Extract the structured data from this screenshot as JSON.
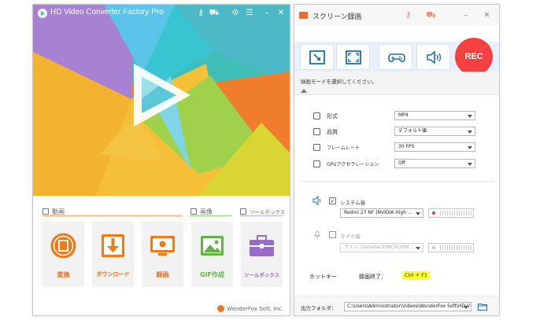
{
  "left_window": {
    "title": "HD Video Converter Factory Pro",
    "sections": {
      "video": "動画",
      "image": "画像",
      "toolbox": "ツールボックス"
    },
    "tiles": [
      {
        "label": "変換",
        "icon": "film-convert-icon"
      },
      {
        "label": "ダウンロード",
        "icon": "download-icon"
      },
      {
        "label": "録画",
        "icon": "screen-recorder-icon"
      },
      {
        "label": "GIF作成",
        "icon": "gif-image-icon"
      },
      {
        "label": "ツールボックス",
        "icon": "toolbox-icon"
      }
    ],
    "footer": "WonderFox Soft, Inc.",
    "colors": {
      "accent": "#ec6a13",
      "toolbox": "#9b6bc9",
      "green": "#62b346"
    }
  },
  "right_window": {
    "title": "スクリーン録画",
    "rec_label": "REC",
    "hint": "録画モードを選択してください。",
    "settings": [
      {
        "label": "形式",
        "value": "MP4"
      },
      {
        "label": "品質",
        "value": "デフォルト値"
      },
      {
        "label": "フレームレート",
        "value": "30 FPS"
      },
      {
        "label": "GPUアクセラレーション",
        "value": "Off"
      }
    ],
    "system_audio": {
      "label": "システム音",
      "device": "Redmi 27 NF (NVIDIA High ...",
      "checked": true
    },
    "mic": {
      "label": "マイク音",
      "device": "ライン (Yamaha SYNCROOM...",
      "checked": false
    },
    "hotkey_label": "ホットキー",
    "stop_label": "録画終了：",
    "stop_key": "Ctrl + F1",
    "output_label": "出力フォルダ：",
    "output_path": "C:\\Users\\Administrator\\Videos\\WonderFox Soft\\HD V",
    "colors": {
      "rec": "#f34141",
      "modebar": "#e8f1fb",
      "highlight": "#ffff33"
    }
  }
}
